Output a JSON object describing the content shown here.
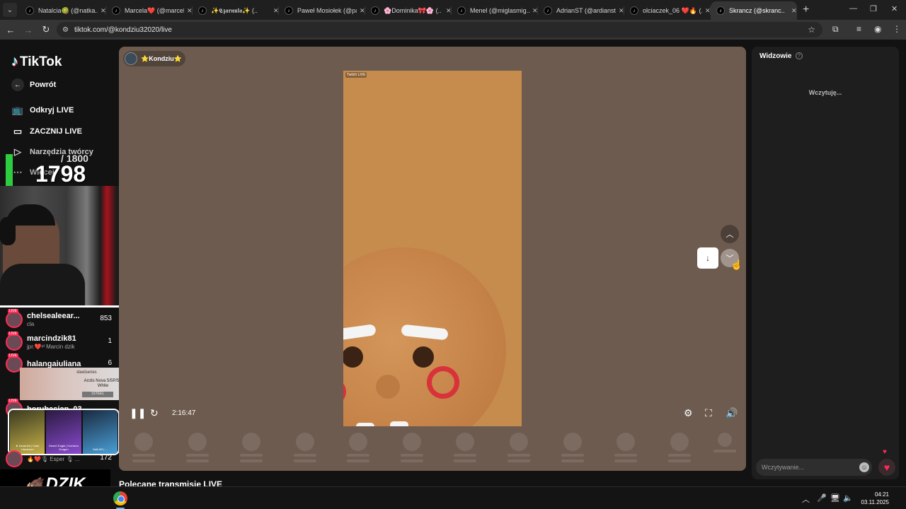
{
  "browser": {
    "tabs": [
      {
        "title": "Natalcia🥝 (@natka..",
        "active": false
      },
      {
        "title": "Marcela❤️ (@marcel..",
        "active": false
      },
      {
        "title": "✨𝕮𝖟𝖆𝖗𝖓𝖚𝖑𝖆✨ (..",
        "active": false
      },
      {
        "title": "Paweł Mosiołek (@pa..",
        "active": false
      },
      {
        "title": "🌸Dominika🎀🌸 (..",
        "active": false
      },
      {
        "title": "Menel (@miglasmig..",
        "active": false
      },
      {
        "title": "AdrianST (@ardianst..",
        "active": false
      },
      {
        "title": "olciaczek_06 ❤️🔥 (..",
        "active": false
      },
      {
        "title": "Skrancz (@skranc..",
        "active": true
      }
    ],
    "url": "tiktok.com/@kondziu32020/live"
  },
  "sidebar": {
    "brand": "TikTok",
    "back_label": "Powrót",
    "items": [
      {
        "label": "Odkryj LIVE",
        "icon": "tv-icon"
      },
      {
        "label": "ZACZNIJ LIVE",
        "icon": "camera-icon"
      },
      {
        "label": "Narzędzia twórcy",
        "icon": "play-circle-icon"
      },
      {
        "label": "Więcej",
        "icon": "more-icon"
      }
    ]
  },
  "overlay": {
    "counter_total": "/ 1800",
    "counter_now": "1798",
    "leaderboard": [
      {
        "name": "chelsealeear...",
        "sub": "cla",
        "score": "853"
      },
      {
        "name": "marcindzik81",
        "sub": "jpr.❤️ᵖˡ Marcin dzik",
        "score": "1"
      },
      {
        "name": "halangaiuliana",
        "sub": "",
        "score": "6"
      },
      {
        "name": "borubasian_03",
        "sub": "",
        "score": ""
      },
      {
        "name": "",
        "sub": "🔥❤️🎙 Esper 🎙 ...",
        "score": "172"
      }
    ],
    "ad": {
      "brand": "steelseries",
      "product": "Arctis Nova 5/5P/5X White",
      "button": "1STEEL"
    },
    "skins": [
      {
        "label": "★ Karambit | Case Hardened",
        "color": "#c8b24a"
      },
      {
        "label": "Desert Eagle | Kumicho Dragon",
        "color": "#8a4bd0"
      },
      {
        "label": "Galil AR | ...",
        "color": "#4aa0d8"
      }
    ],
    "logo_text": "DZIK"
  },
  "player": {
    "host_name": "⭐Kondziu⭐",
    "video_tag": "Twitch LIVE",
    "time": "2:16:47"
  },
  "recommended_title": "Polecane transmisje LIVE",
  "viewers_panel": {
    "title": "Widzowie",
    "loading": "Wczytuję...",
    "input_placeholder": "Wczytywanie..."
  },
  "taskbar": {
    "time": "04:21",
    "date": "03.11.2025"
  }
}
